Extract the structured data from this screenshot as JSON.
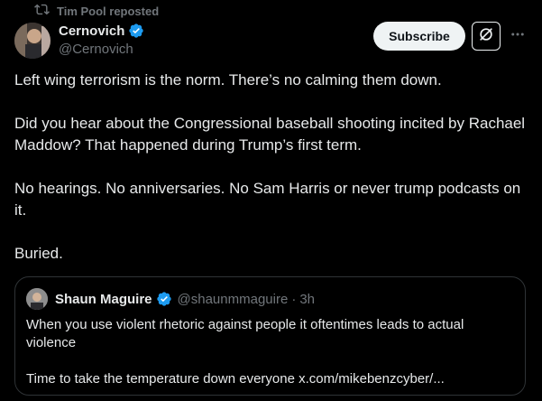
{
  "repost": {
    "label": "Tim Pool reposted",
    "icon": "repost-icon"
  },
  "author": {
    "display_name": "Cernovich",
    "handle": "@Cernovich",
    "verified_icon": "verified-badge-icon",
    "verified_color": "#1d9bf0"
  },
  "actions": {
    "subscribe_label": "Subscribe",
    "grok_icon": "grok-icon",
    "more_icon": "more-icon"
  },
  "tweet": {
    "paragraphs": [
      "Left wing terrorism is the norm. There’s no calming them down.",
      "Did you hear about the Congressional baseball shooting incited by Rachael Maddow? That happened during Trump’s first term.",
      "No hearings. No anniversaries. No Sam Harris or never trump podcasts on it.",
      "Buried."
    ]
  },
  "quote": {
    "display_name": "Shaun Maguire",
    "handle": "@shaunmmaguire",
    "separator": "·",
    "time": "3h",
    "paragraphs": [
      "When you use violent rhetoric against people it oftentimes leads to actual violence",
      "Time to take the temperature down everyone x.com/mikebenzcyber/..."
    ]
  },
  "colors": {
    "background": "#000000",
    "text": "#e7e9ea",
    "muted": "#71767b",
    "border": "#2f3336",
    "accent": "#1d9bf0",
    "button_bg": "#eff3f4"
  }
}
